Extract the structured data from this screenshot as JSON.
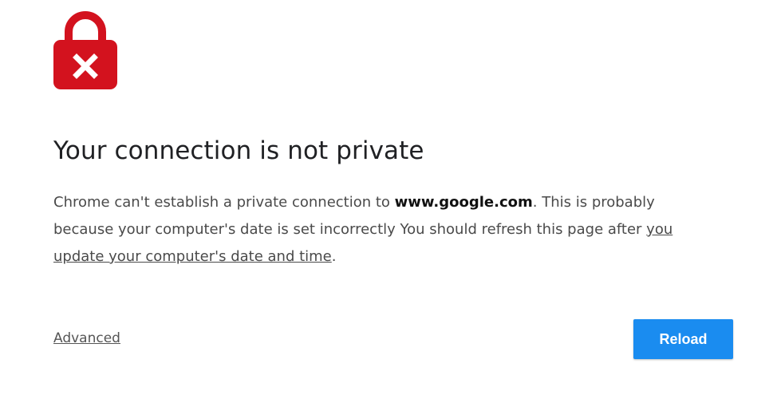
{
  "colors": {
    "lock_red": "#d3121e",
    "button_blue": "#1a8cf0",
    "heading_text": "#202124"
  },
  "icon": "lock-error-icon",
  "heading": "Your connection is not private",
  "message": {
    "part1": "Chrome can't establish a private connection to ",
    "host": "www.google.com",
    "part2": ". This is probably because your computer's date is set incorrectly You should refresh this page after ",
    "link_text": "you update your computer's date and time",
    "part3": "."
  },
  "actions": {
    "advanced_label": "Advanced",
    "reload_label": "Reload"
  }
}
